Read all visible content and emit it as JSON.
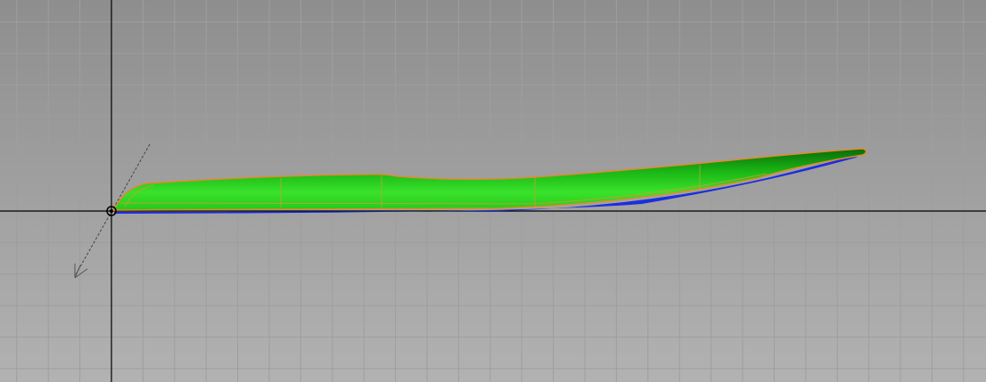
{
  "viewport": {
    "colors": {
      "surface": "#22c81a",
      "surface_dark": "#0e7a0c",
      "edge": "#e08a2a",
      "underside": "#1a2ee0",
      "grid": "#9c9c9c",
      "axis": "#000000"
    }
  }
}
